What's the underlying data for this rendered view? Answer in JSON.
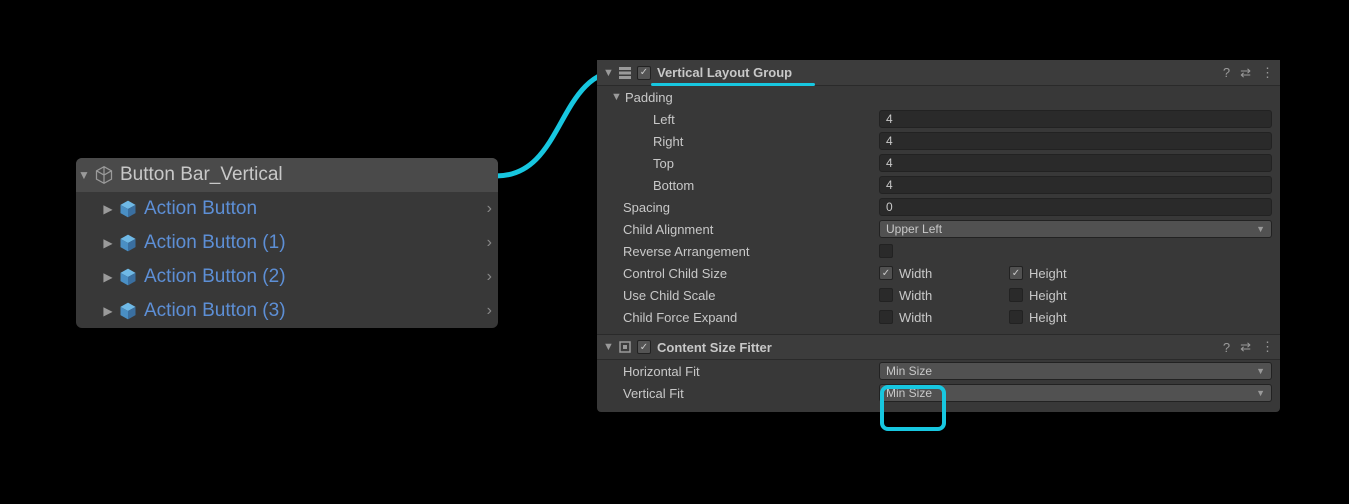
{
  "hierarchy": {
    "parent": "Button Bar_Vertical",
    "children": [
      "Action Button",
      "Action Button (1)",
      "Action Button (2)",
      "Action Button (3)"
    ]
  },
  "vlg": {
    "title": "Vertical Layout Group",
    "padding_label": "Padding",
    "left_label": "Left",
    "left": "4",
    "right_label": "Right",
    "right": "4",
    "top_label": "Top",
    "top": "4",
    "bottom_label": "Bottom",
    "bottom": "4",
    "spacing_label": "Spacing",
    "spacing": "0",
    "child_align_label": "Child Alignment",
    "child_align": "Upper Left",
    "reverse_label": "Reverse Arrangement",
    "control_label": "Control Child Size",
    "scale_label": "Use Child Scale",
    "expand_label": "Child Force Expand",
    "width": "Width",
    "height": "Height"
  },
  "csf": {
    "title": "Content Size Fitter",
    "hfit_label": "Horizontal Fit",
    "hfit": "Min Size",
    "vfit_label": "Vertical Fit",
    "vfit": "Min Size"
  }
}
